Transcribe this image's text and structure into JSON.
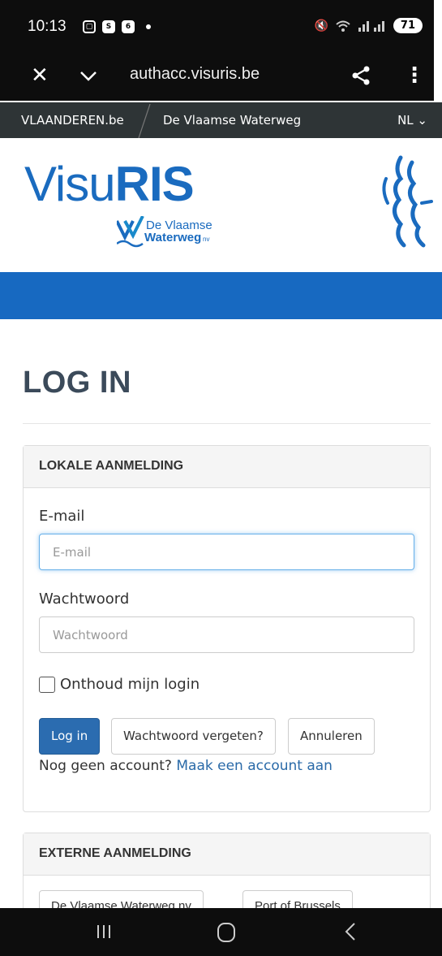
{
  "status_bar": {
    "time": "10:13",
    "icon_s": "S",
    "icon_6": "6",
    "battery": "71"
  },
  "browser": {
    "url": "authacc.visuris.be"
  },
  "vl_bar": {
    "vlaanderen": "VLAANDEREN.be",
    "org": "De Vlaamse Waterweg",
    "lang": "NL"
  },
  "logo": {
    "visu": "Visu",
    "ris": "RIS",
    "sub_line1": "De Vlaamse",
    "sub_line2": "Waterweg",
    "sub_suffix": "nv"
  },
  "page": {
    "title": "LOG IN"
  },
  "local_login": {
    "heading": "LOKALE AANMELDING",
    "email_label": "E-mail",
    "email_placeholder": "E-mail",
    "password_label": "Wachtwoord",
    "password_placeholder": "Wachtwoord",
    "remember_label": "Onthoud mijn login",
    "login_button": "Log in",
    "forgot_button": "Wachtwoord vergeten?",
    "cancel_button": "Annuleren",
    "no_account_text": "Nog geen account?",
    "create_account_link": "Maak een account aan"
  },
  "external_login": {
    "heading": "EXTERNE AANMELDING",
    "provider_1": "De Vlaamse Waterweg nv",
    "provider_2": "Port of Brussels"
  },
  "colors": {
    "brand_blue": "#1769c1",
    "primary_button": "#2b6cb0",
    "link": "#2a6aa8",
    "vl_bar": "#2e3436"
  }
}
